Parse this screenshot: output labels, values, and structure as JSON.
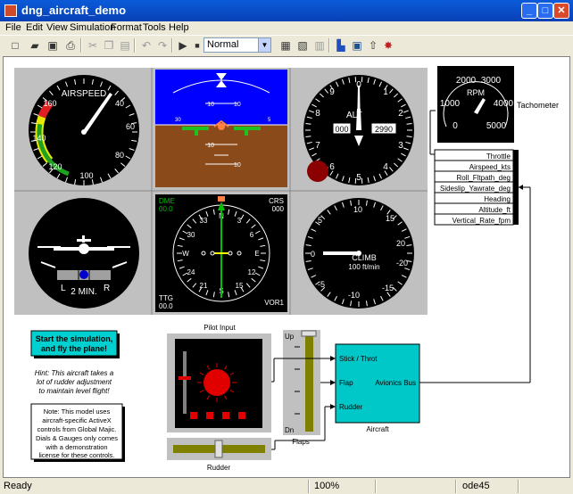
{
  "window": {
    "title": "dng_aircraft_demo"
  },
  "menu": [
    "File",
    "Edit",
    "View",
    "Simulation",
    "Format",
    "Tools",
    "Help"
  ],
  "toolbar": {
    "sim_mode": "Normal"
  },
  "instruments": {
    "airspeed": {
      "label": "AIRSPEED",
      "ticks": [
        "160",
        "40",
        "140",
        "60",
        "120",
        "80",
        "100"
      ]
    },
    "altimeter": {
      "label": "ALT",
      "drum_left": "000",
      "drum_right": "2990",
      "ticks": [
        "0",
        "1",
        "2",
        "3",
        "4",
        "5",
        "6",
        "7",
        "8",
        "9"
      ]
    },
    "attitude": {
      "pitch_labels": [
        "10",
        "10",
        "10",
        "10"
      ],
      "side_left": "30",
      "side_right": "5"
    },
    "turn_coordinator": {
      "left": "L",
      "right": "R",
      "label": "2 MIN."
    },
    "hsi": {
      "dme_label": "DME",
      "dme_value": "00.0",
      "crs_label": "CRS",
      "crs_value": "000",
      "ttg_label": "TTG",
      "ttg_value": "00.0",
      "vor_label": "VOR1",
      "ticks": [
        "N",
        "3",
        "6",
        "E",
        "12",
        "15",
        "S",
        "21",
        "24",
        "W",
        "30",
        "33"
      ]
    },
    "vsi": {
      "label": "CLIMB",
      "unit": "100 ft/min",
      "ticks": [
        "0",
        "5",
        "10",
        "15",
        "20",
        "-5",
        "-10",
        "-15",
        "-20"
      ]
    },
    "tachometer": {
      "rpm_label": "RPM",
      "ticks": [
        "2000",
        "3000",
        "1000",
        "4000",
        "0",
        "5000"
      ],
      "name": "Tachometer"
    }
  },
  "bus_signals": [
    "Throttle",
    "Airspeed_kts",
    "Roll_Fltpath_deg",
    "Sideslip_Yawrate_deg",
    "Heading",
    "Altitude_ft",
    "Vertical_Rate_fpm"
  ],
  "blocks": {
    "start_text": "Start the simulation, and fly the plane!",
    "hint": "Hint: This aircraft takes a lot of rudder adjustment to maintain level flight!",
    "note": "Note: This model uses aircraft-specific ActiveX controls from Global Majic. Dials & Gauges only comes with a demonstration license for these controls.",
    "pilot_input": "Pilot Input",
    "rudder": "Rudder",
    "flaps": "Flaps",
    "flap_up": "Up",
    "flap_dn": "Dn",
    "aircraft": "Aircraft",
    "ports": [
      "Stick / Throt",
      "Flap",
      "Rudder"
    ],
    "out_port": "Avionics Bus"
  },
  "status": {
    "left": "Ready",
    "zoom": "100%",
    "solver": "ode45"
  }
}
